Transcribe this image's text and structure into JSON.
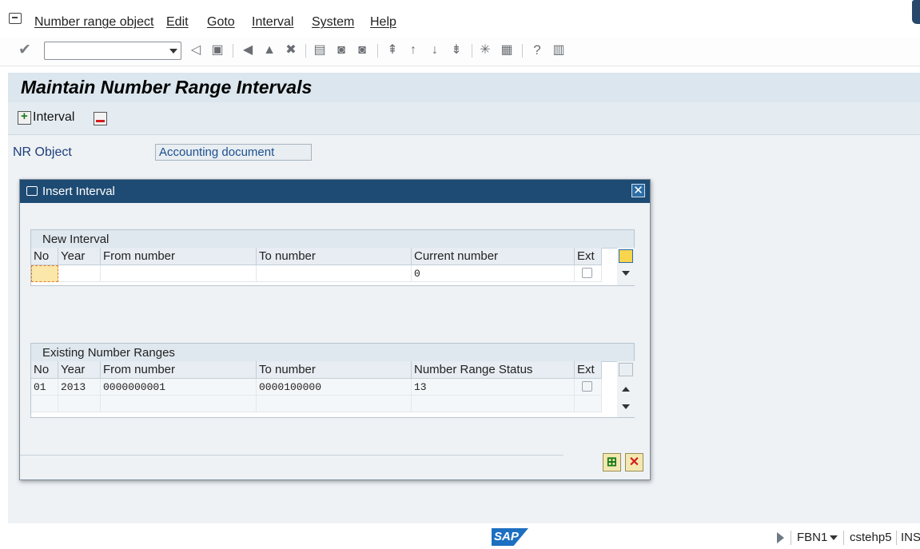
{
  "menu": {
    "items": [
      "Number range object",
      "Edit",
      "Goto",
      "Interval",
      "System",
      "Help"
    ]
  },
  "toolbar": {
    "command_field_value": "",
    "icons": [
      "enter-icon",
      "back-icon",
      "save-icon",
      "back-nav-icon",
      "exit-icon",
      "cancel-icon",
      "print-icon",
      "find-icon",
      "find-next-icon",
      "first-page-icon",
      "previous-page-icon",
      "next-page-icon",
      "last-page-icon",
      "create-session-icon",
      "shortcut-icon",
      "help-icon",
      "customize-layout-icon"
    ]
  },
  "page": {
    "title": "Maintain Number Range Intervals",
    "interval_button_label": "Interval",
    "nr_object_label": "NR Object",
    "nr_object_value": "Accounting document"
  },
  "dialog": {
    "title": "Insert Interval",
    "new_interval": {
      "group_title": "New Interval",
      "columns": [
        "No",
        "Year",
        "From number",
        "To number",
        "Current number",
        "Ext"
      ],
      "row": {
        "no": "",
        "year": "",
        "from": "",
        "to": "",
        "current": "0",
        "ext": false
      }
    },
    "existing_ranges": {
      "group_title": "Existing Number Ranges",
      "columns": [
        "No",
        "Year",
        "From number",
        "To number",
        "Number Range Status",
        "Ext"
      ],
      "rows": [
        {
          "no": "01",
          "year": "2013",
          "from": "0000000001",
          "to": "0000100000",
          "status": "13",
          "ext": false
        }
      ]
    }
  },
  "statusbar": {
    "logo": "SAP",
    "transaction": "FBN1",
    "server": "cstehp5",
    "mode": "INS"
  }
}
